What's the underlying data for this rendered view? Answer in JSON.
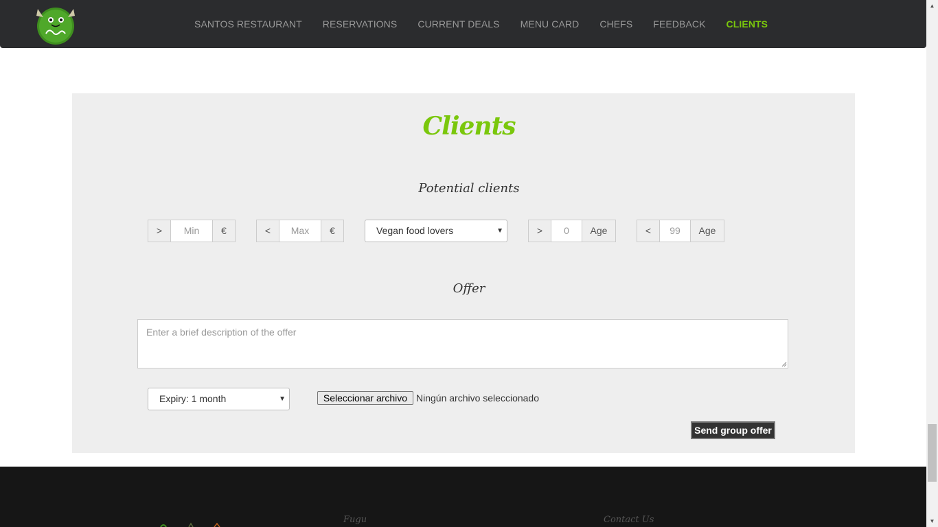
{
  "nav": {
    "items": [
      "SANTOS RESTAURANT",
      "RESERVATIONS",
      "CURRENT DEALS",
      "MENU CARD",
      "CHEFS",
      "FEEDBACK",
      "CLIENTS"
    ],
    "active_index": 6
  },
  "section": {
    "title": "Clients",
    "potential_title": "Potential clients",
    "filters": {
      "min": {
        "prefix": ">",
        "placeholder": "Min",
        "suffix": "€"
      },
      "max": {
        "prefix": "<",
        "placeholder": "Max",
        "suffix": "€"
      },
      "segment": {
        "value": "Vegan food lovers"
      },
      "age_min": {
        "prefix": ">",
        "placeholder": "0",
        "suffix": "Age"
      },
      "age_max": {
        "prefix": "<",
        "placeholder": "99",
        "suffix": "Age"
      }
    },
    "offer_title": "Offer",
    "offer_placeholder": "Enter a brief description of the offer",
    "expiry": "Expiry: 1 month",
    "file_button": "Seleccionar archivo",
    "file_status": "Ningún archivo seleccionado",
    "send_button": "Send group offer"
  },
  "footer": {
    "col1_title": "Fugu",
    "col2_title": "Contact Us"
  },
  "colors": {
    "accent": "#7ac70c",
    "navbar": "#2b2c2e",
    "section_bg": "#eeeeee",
    "footer_bg": "#161616"
  }
}
